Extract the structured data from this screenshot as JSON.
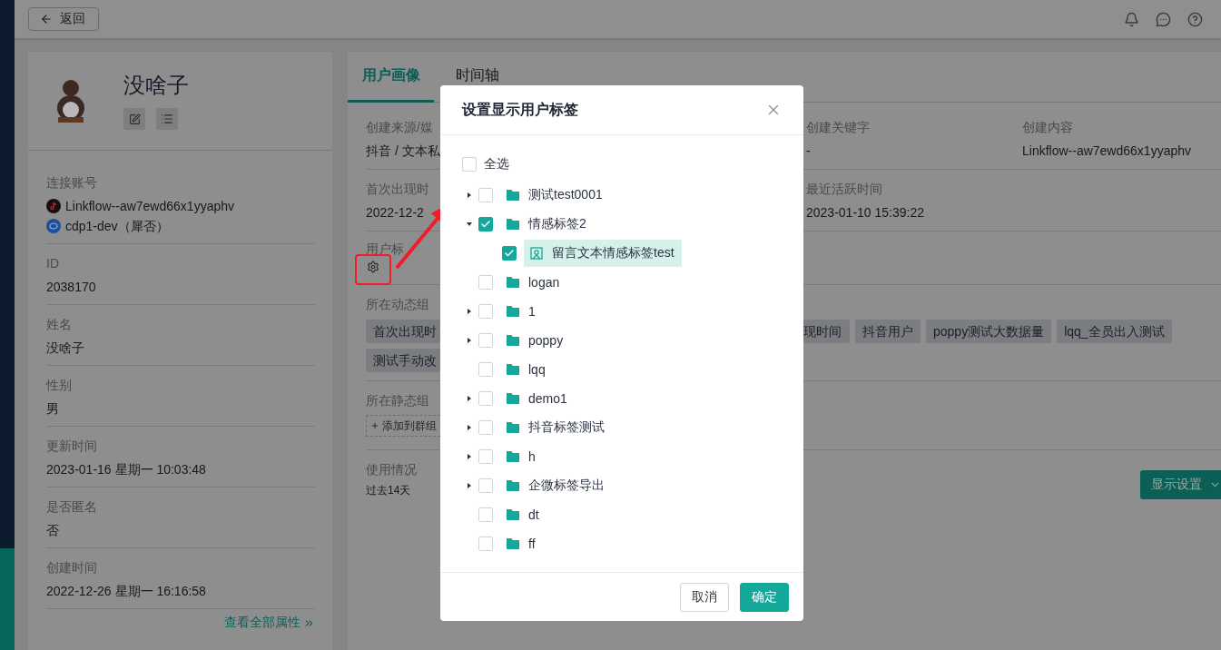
{
  "top_bar": {
    "back_button": "返回"
  },
  "profile": {
    "name": "没啥子",
    "fields": [
      {
        "label": "连接账号",
        "accounts": [
          {
            "kind": "douyin",
            "text": "Linkflow--aw7ewd66x1yyaphv"
          },
          {
            "kind": "wecom",
            "text": "cdp1-dev（犀否）"
          }
        ]
      },
      {
        "label": "ID",
        "value": "2038170"
      },
      {
        "label": "姓名",
        "value": "没啥子"
      },
      {
        "label": "性别",
        "value": "男"
      },
      {
        "label": "更新时间",
        "value": "2023-01-16 星期一 10:03:48"
      },
      {
        "label": "是否匿名",
        "value": "否"
      },
      {
        "label": "创建时间",
        "value": "2022-12-26 星期一 16:16:58"
      }
    ],
    "view_all_link": "查看全部属性"
  },
  "detail_panel": {
    "tabs": [
      {
        "label": "用户画像",
        "selected": true
      },
      {
        "label": "时间轴",
        "selected": false
      }
    ],
    "info_rows": [
      {
        "left": {
          "label": "创建来源/媒",
          "value": "抖音 / 文本私"
        },
        "right": [
          {
            "label": "创建关键字",
            "value": "-"
          },
          {
            "label": "创建内容",
            "value": "Linkflow--aw7ewd66x1yyaphv"
          }
        ]
      },
      {
        "left": {
          "label": "首次出现时",
          "value": "2022-12-2"
        },
        "right": [
          {
            "label": "最近活跃时间",
            "value": "2023-01-10 15:39:22"
          }
        ]
      }
    ],
    "user_tags": {
      "label": "用户标"
    },
    "dynamic_groups": {
      "label": "所在动态组",
      "left_tags": [
        "首次出现时",
        "测试手动改"
      ],
      "right_tags": [
        "现时间",
        "抖音用户",
        "poppy测试大数据量",
        "lqq_全员出入测试"
      ]
    },
    "static_groups": {
      "label": "所在静态组",
      "add_button": "添加到群组"
    },
    "usage": {
      "label": "使用情况",
      "period": "过去14天",
      "display_button": "显示设置"
    }
  },
  "modal": {
    "title": "设置显示用户标签",
    "select_all": {
      "label": "全选",
      "checked": false
    },
    "tree": [
      {
        "label": "测试test0001",
        "kind": "folder",
        "expanded": false,
        "checked": false,
        "selected": false
      },
      {
        "label": "情感标签2",
        "kind": "folder",
        "expanded": true,
        "checked": true,
        "selected": false,
        "children": [
          {
            "label": "留言文本情感标签test",
            "kind": "tag",
            "checked": true,
            "selected": true
          }
        ]
      },
      {
        "label": "logan",
        "kind": "folder",
        "checked": false,
        "selected": false
      },
      {
        "label": "1",
        "kind": "folder",
        "expanded": false,
        "checked": false,
        "selected": false
      },
      {
        "label": "poppy",
        "kind": "folder",
        "expanded": false,
        "checked": false,
        "selected": false
      },
      {
        "label": "lqq",
        "kind": "folder",
        "checked": false,
        "selected": false
      },
      {
        "label": "demo1",
        "kind": "folder",
        "expanded": false,
        "checked": false,
        "selected": false
      },
      {
        "label": "抖音标签测试",
        "kind": "folder",
        "expanded": false,
        "checked": false,
        "selected": false
      },
      {
        "label": "h",
        "kind": "folder",
        "expanded": false,
        "checked": false,
        "selected": false
      },
      {
        "label": "企微标签导出",
        "kind": "folder",
        "expanded": false,
        "checked": false,
        "selected": false
      },
      {
        "label": "dt",
        "kind": "folder",
        "checked": false,
        "selected": false
      },
      {
        "label": "ff",
        "kind": "folder",
        "checked": false,
        "selected": false
      }
    ],
    "buttons": [
      {
        "label": "取消",
        "kind": "secondary"
      },
      {
        "label": "确定",
        "kind": "primary"
      }
    ]
  }
}
